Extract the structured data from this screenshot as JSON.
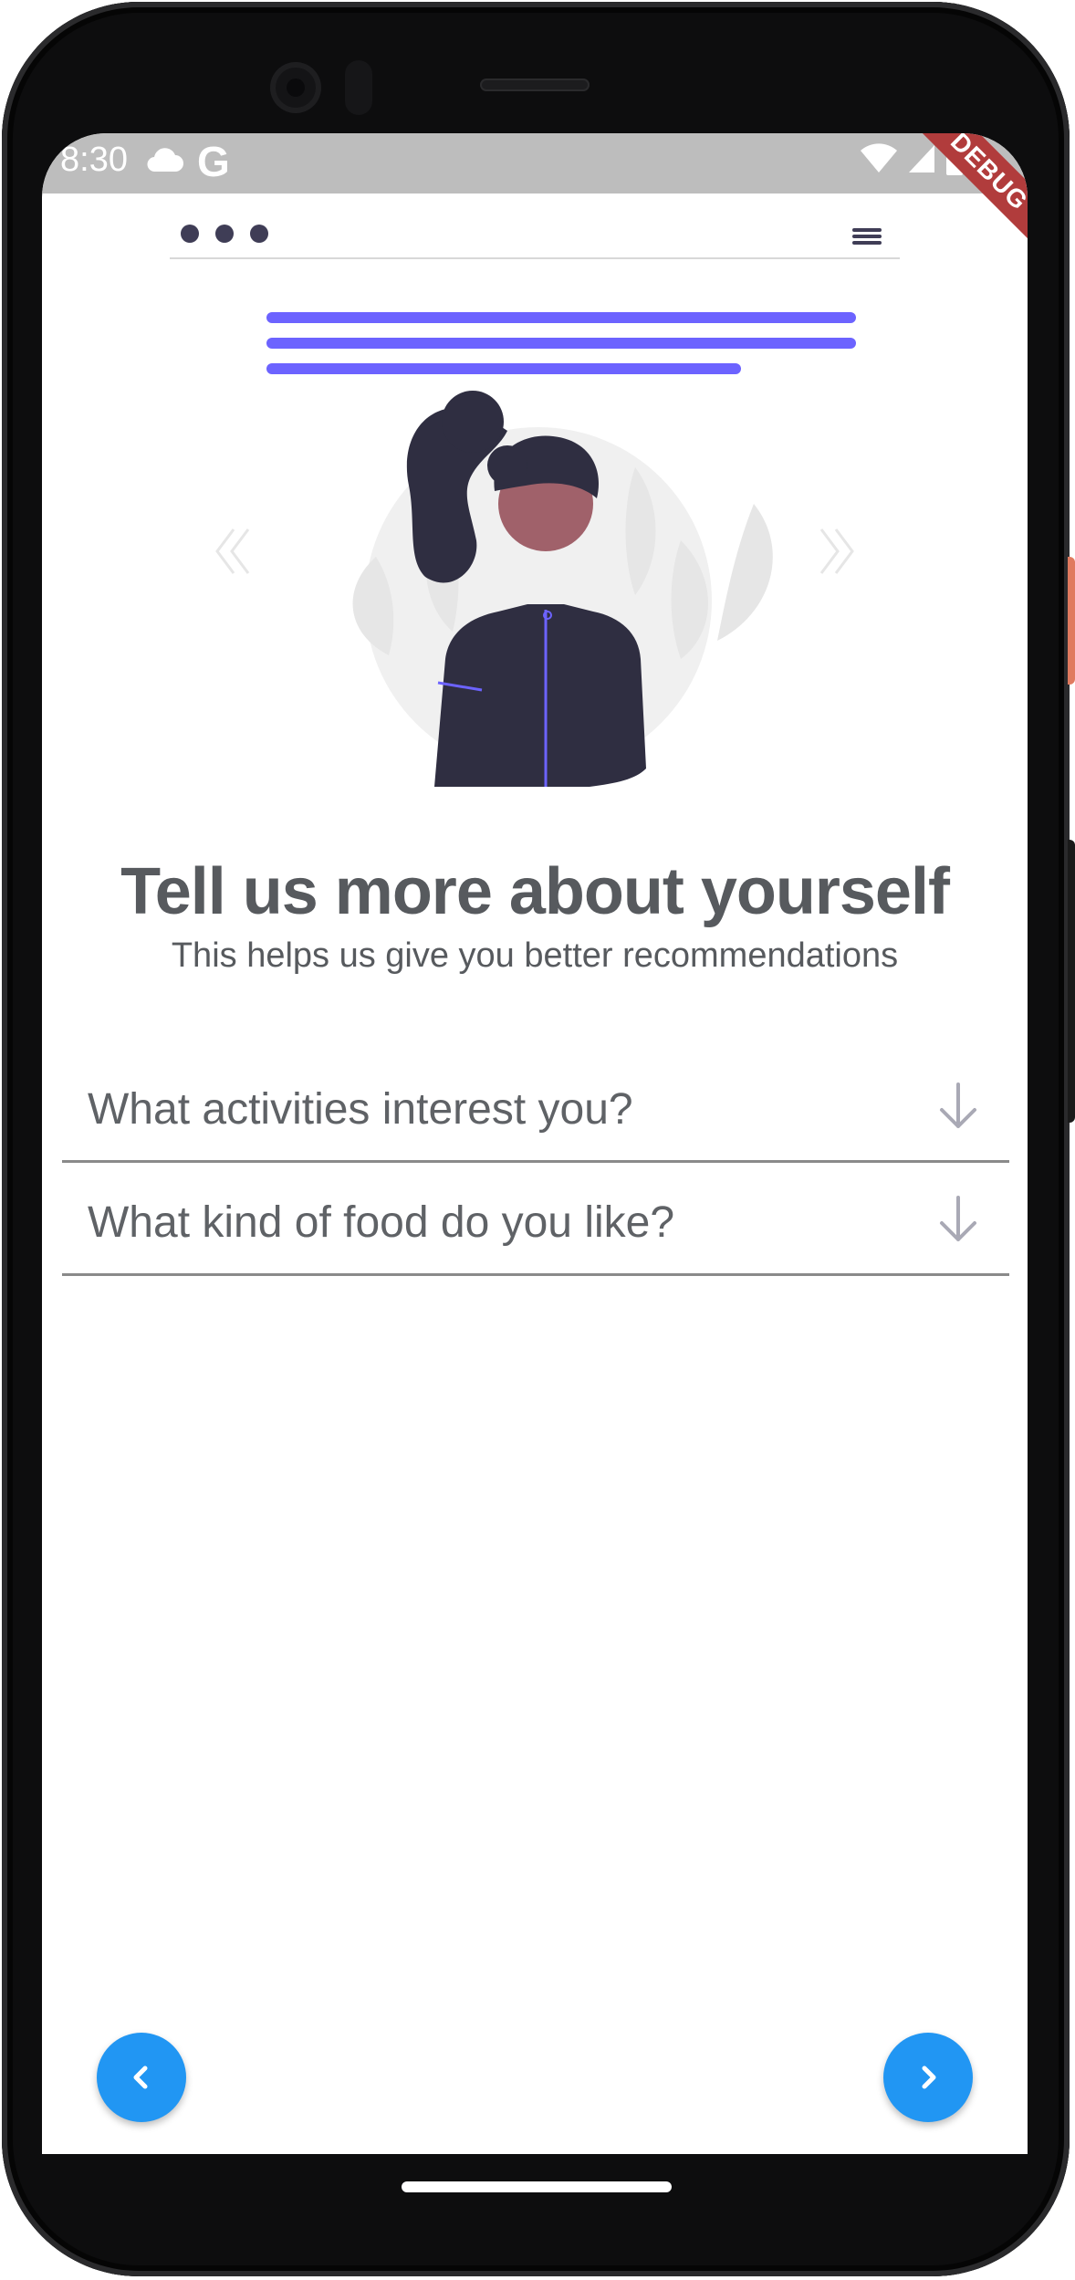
{
  "status_bar": {
    "time": "8:30",
    "google_icon": "G",
    "debug_banner": "DEBUG"
  },
  "page": {
    "title": "Tell us more about yourself",
    "subtitle": "This helps us give you better recommendations"
  },
  "questions": [
    {
      "label": "What activities interest you?",
      "icon": "arrow-down-icon"
    },
    {
      "label": "What kind of food do you like?",
      "icon": "arrow-down-icon"
    }
  ],
  "colors": {
    "accent": "#6c63ff",
    "dark": "#3f3d56",
    "fab": "#2196f3",
    "skin": "#a0616a",
    "debug": "#b13c3c"
  }
}
